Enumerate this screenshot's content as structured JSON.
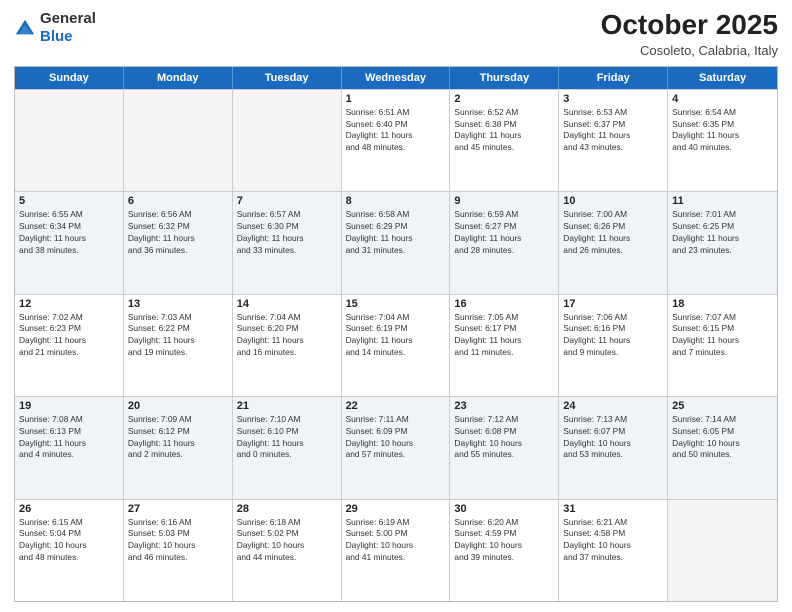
{
  "header": {
    "logo_line1": "General",
    "logo_line2": "Blue",
    "month": "October 2025",
    "location": "Cosoleto, Calabria, Italy"
  },
  "weekdays": [
    "Sunday",
    "Monday",
    "Tuesday",
    "Wednesday",
    "Thursday",
    "Friday",
    "Saturday"
  ],
  "rows": [
    [
      {
        "day": "",
        "info": ""
      },
      {
        "day": "",
        "info": ""
      },
      {
        "day": "",
        "info": ""
      },
      {
        "day": "1",
        "info": "Sunrise: 6:51 AM\nSunset: 6:40 PM\nDaylight: 11 hours\nand 48 minutes."
      },
      {
        "day": "2",
        "info": "Sunrise: 6:52 AM\nSunset: 6:38 PM\nDaylight: 11 hours\nand 45 minutes."
      },
      {
        "day": "3",
        "info": "Sunrise: 6:53 AM\nSunset: 6:37 PM\nDaylight: 11 hours\nand 43 minutes."
      },
      {
        "day": "4",
        "info": "Sunrise: 6:54 AM\nSunset: 6:35 PM\nDaylight: 11 hours\nand 40 minutes."
      }
    ],
    [
      {
        "day": "5",
        "info": "Sunrise: 6:55 AM\nSunset: 6:34 PM\nDaylight: 11 hours\nand 38 minutes."
      },
      {
        "day": "6",
        "info": "Sunrise: 6:56 AM\nSunset: 6:32 PM\nDaylight: 11 hours\nand 36 minutes."
      },
      {
        "day": "7",
        "info": "Sunrise: 6:57 AM\nSunset: 6:30 PM\nDaylight: 11 hours\nand 33 minutes."
      },
      {
        "day": "8",
        "info": "Sunrise: 6:58 AM\nSunset: 6:29 PM\nDaylight: 11 hours\nand 31 minutes."
      },
      {
        "day": "9",
        "info": "Sunrise: 6:59 AM\nSunset: 6:27 PM\nDaylight: 11 hours\nand 28 minutes."
      },
      {
        "day": "10",
        "info": "Sunrise: 7:00 AM\nSunset: 6:26 PM\nDaylight: 11 hours\nand 26 minutes."
      },
      {
        "day": "11",
        "info": "Sunrise: 7:01 AM\nSunset: 6:25 PM\nDaylight: 11 hours\nand 23 minutes."
      }
    ],
    [
      {
        "day": "12",
        "info": "Sunrise: 7:02 AM\nSunset: 6:23 PM\nDaylight: 11 hours\nand 21 minutes."
      },
      {
        "day": "13",
        "info": "Sunrise: 7:03 AM\nSunset: 6:22 PM\nDaylight: 11 hours\nand 19 minutes."
      },
      {
        "day": "14",
        "info": "Sunrise: 7:04 AM\nSunset: 6:20 PM\nDaylight: 11 hours\nand 16 minutes."
      },
      {
        "day": "15",
        "info": "Sunrise: 7:04 AM\nSunset: 6:19 PM\nDaylight: 11 hours\nand 14 minutes."
      },
      {
        "day": "16",
        "info": "Sunrise: 7:05 AM\nSunset: 6:17 PM\nDaylight: 11 hours\nand 11 minutes."
      },
      {
        "day": "17",
        "info": "Sunrise: 7:06 AM\nSunset: 6:16 PM\nDaylight: 11 hours\nand 9 minutes."
      },
      {
        "day": "18",
        "info": "Sunrise: 7:07 AM\nSunset: 6:15 PM\nDaylight: 11 hours\nand 7 minutes."
      }
    ],
    [
      {
        "day": "19",
        "info": "Sunrise: 7:08 AM\nSunset: 6:13 PM\nDaylight: 11 hours\nand 4 minutes."
      },
      {
        "day": "20",
        "info": "Sunrise: 7:09 AM\nSunset: 6:12 PM\nDaylight: 11 hours\nand 2 minutes."
      },
      {
        "day": "21",
        "info": "Sunrise: 7:10 AM\nSunset: 6:10 PM\nDaylight: 11 hours\nand 0 minutes."
      },
      {
        "day": "22",
        "info": "Sunrise: 7:11 AM\nSunset: 6:09 PM\nDaylight: 10 hours\nand 57 minutes."
      },
      {
        "day": "23",
        "info": "Sunrise: 7:12 AM\nSunset: 6:08 PM\nDaylight: 10 hours\nand 55 minutes."
      },
      {
        "day": "24",
        "info": "Sunrise: 7:13 AM\nSunset: 6:07 PM\nDaylight: 10 hours\nand 53 minutes."
      },
      {
        "day": "25",
        "info": "Sunrise: 7:14 AM\nSunset: 6:05 PM\nDaylight: 10 hours\nand 50 minutes."
      }
    ],
    [
      {
        "day": "26",
        "info": "Sunrise: 6:15 AM\nSunset: 5:04 PM\nDaylight: 10 hours\nand 48 minutes."
      },
      {
        "day": "27",
        "info": "Sunrise: 6:16 AM\nSunset: 5:03 PM\nDaylight: 10 hours\nand 46 minutes."
      },
      {
        "day": "28",
        "info": "Sunrise: 6:18 AM\nSunset: 5:02 PM\nDaylight: 10 hours\nand 44 minutes."
      },
      {
        "day": "29",
        "info": "Sunrise: 6:19 AM\nSunset: 5:00 PM\nDaylight: 10 hours\nand 41 minutes."
      },
      {
        "day": "30",
        "info": "Sunrise: 6:20 AM\nSunset: 4:59 PM\nDaylight: 10 hours\nand 39 minutes."
      },
      {
        "day": "31",
        "info": "Sunrise: 6:21 AM\nSunset: 4:58 PM\nDaylight: 10 hours\nand 37 minutes."
      },
      {
        "day": "",
        "info": ""
      }
    ]
  ]
}
